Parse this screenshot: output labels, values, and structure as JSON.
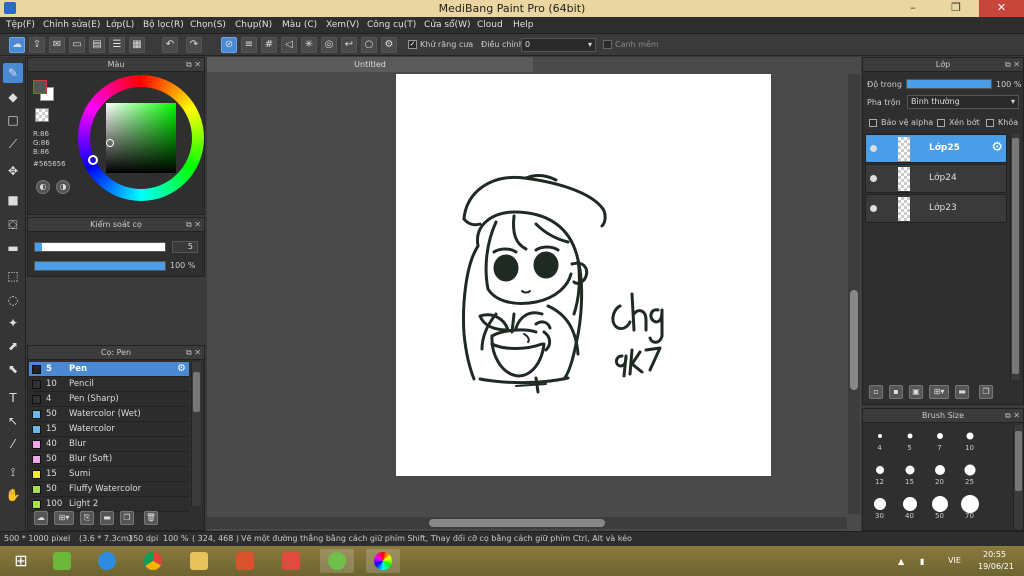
{
  "window": {
    "title": "MediBang Paint Pro (64bit)",
    "minimize": "–",
    "maximize": "❐",
    "close": "✕"
  },
  "menu": [
    "Tệp(F)",
    "Chỉnh sửa(E)",
    "Lớp(L)",
    "Bộ lọc(R)",
    "Chọn(S)",
    "Chụp(N)",
    "Màu (C)",
    "Xem(V)",
    "Công cụ(T)",
    "Cửa sổ(W)",
    "Cloud",
    "Help"
  ],
  "toolbar": {
    "antialias_label": "Khử răng cưa",
    "antialias_checked": true,
    "correction_label": "Điều chỉnh",
    "correction_value": "0",
    "snap_label": "Canh mềm"
  },
  "color_panel": {
    "title": "Màu",
    "r": "R:86",
    "g": "G:86",
    "b": "B:86",
    "hex": "#565656",
    "foreground_color": "#565656"
  },
  "brush_control": {
    "title": "Kiểm soát cọ",
    "size_value": "5",
    "size_fraction": 0.05,
    "opacity_value": "100 %",
    "opacity_fraction": 1.0
  },
  "brush_list": {
    "title": "Cọ: Pen",
    "items": [
      {
        "size": "5",
        "name": "Pen",
        "color": "#222222",
        "active": true
      },
      {
        "size": "10",
        "name": "Pencil",
        "color": "#333333"
      },
      {
        "size": "4",
        "name": "Pen (Sharp)",
        "color": "#333333"
      },
      {
        "size": "50",
        "name": "Watercolor (Wet)",
        "color": "#6ab7ea"
      },
      {
        "size": "15",
        "name": "Watercolor",
        "color": "#6ab7ea"
      },
      {
        "size": "40",
        "name": "Blur",
        "color": "#f2a8e8"
      },
      {
        "size": "50",
        "name": "Blur (Soft)",
        "color": "#f2a8e8"
      },
      {
        "size": "15",
        "name": "Sumi",
        "color": "#f0e83a"
      },
      {
        "size": "50",
        "name": "Fluffy Watercolor",
        "color": "#a8e050"
      },
      {
        "size": "100",
        "name": "Light 2",
        "color": "#a8e050"
      }
    ]
  },
  "canvas": {
    "tab_title": "Untitled",
    "signature_text": "Chg 9K7"
  },
  "layer_panel": {
    "title": "Lớp",
    "opacity_label": "Độ trong",
    "opacity_value": "100 %",
    "opacity_fraction": 1.0,
    "blend_label": "Pha trộn",
    "blend_value": "Bình thường",
    "protect_alpha": "Bảo vệ alpha",
    "clipping": "Xén bớt",
    "lock": "Khóa",
    "layers": [
      {
        "name": "Lớp25",
        "active": true
      },
      {
        "name": "Lớp24"
      },
      {
        "name": "Lớp23"
      }
    ]
  },
  "brush_size_panel": {
    "title": "Brush Size",
    "sizes": [
      "4",
      "5",
      "7",
      "10",
      "12",
      "15",
      "20",
      "25",
      "30",
      "40",
      "50",
      "70"
    ]
  },
  "status": {
    "dimensions": "500 * 1000 pixel",
    "physical": "(3.6 * 7.3cm)",
    "dpi": "350 dpi",
    "zoom": "100 %",
    "coords": "( 324, 468 )",
    "hint": "Vẽ một đường thẳng bằng cách giữ phím Shift, Thay đổi cỡ cọ bằng cách giữ phím Ctrl, Alt và kéo"
  },
  "taskbar": {
    "lang": "VIE",
    "time": "20:55",
    "date": "19/06/21"
  },
  "colors": {
    "accent": "#4a8ad4",
    "panel": "#2f2f2f",
    "taskbar": "#7d7238"
  }
}
